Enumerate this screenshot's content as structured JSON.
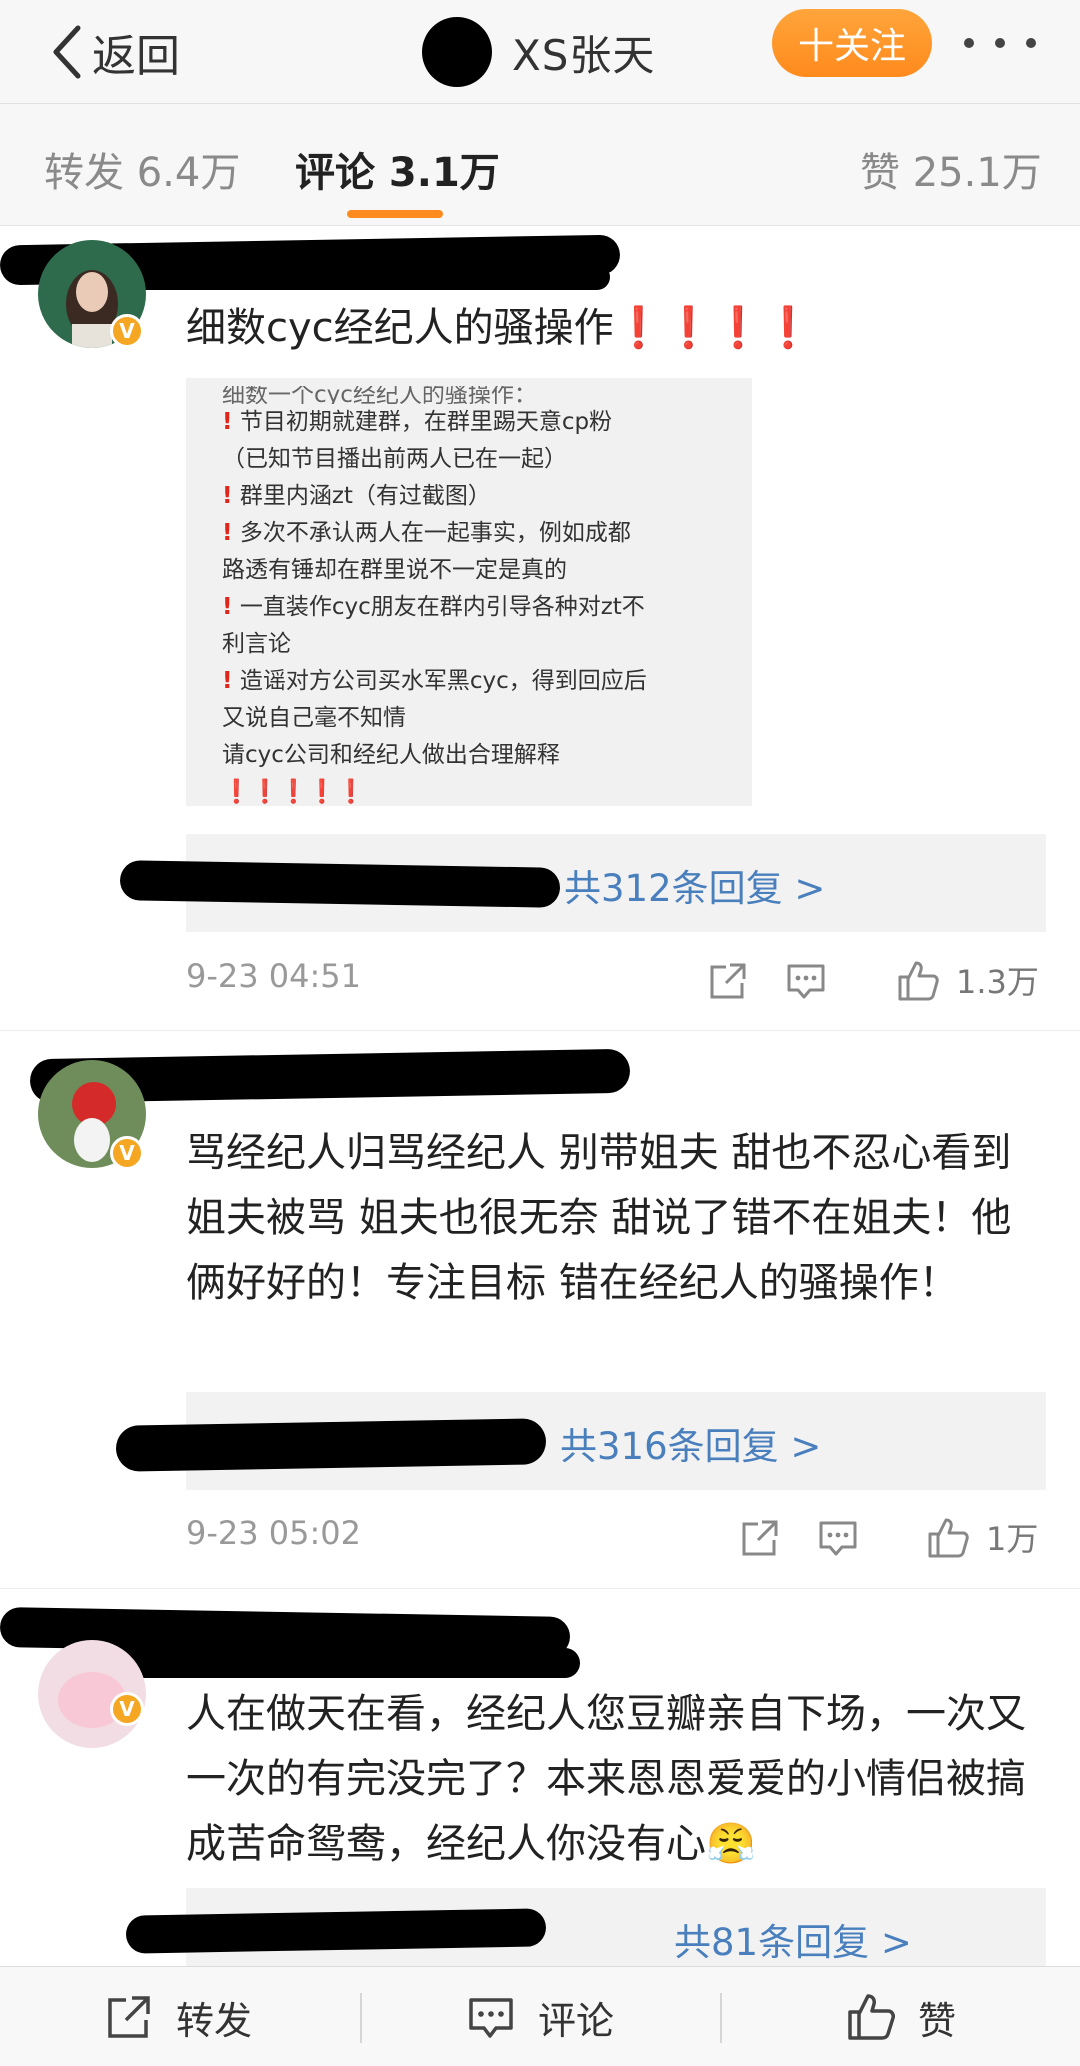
{
  "nav": {
    "back_label": "返回",
    "username": "XS张天",
    "follow_label": "十关注"
  },
  "tabs": {
    "repost": "转发 6.4万",
    "comment": "评论 3.1万",
    "like": "赞 25.1万"
  },
  "comments": [
    {
      "text": "细数cyc经纪人的骚操作",
      "text_suffix": "❗️❗️❗️❗️",
      "image_lines": [
        "细数一个cyc经纪人的骚操作：",
        "节目初期就建群，在群里踢天意cp粉",
        "（已知节目播出前两人已在一起）",
        "群里内涵zt（有过截图）",
        "多次不承认两人在一起事实，例如成都",
        "路透有锤却在群里说不一定是真的",
        "一直装作cyc朋友在群内引导各种对zt不",
        "利言论",
        "造谣对方公司买水军黑cyc，得到回应后",
        "又说自己毫不知情",
        "请cyc公司和经纪人做出合理解释",
        "❗️❗️❗️❗️❗️"
      ],
      "reply_link": "共312条回复 >",
      "time": "9-23 04:51",
      "likes": "1.3万"
    },
    {
      "text": "骂经纪人归骂经纪人 别带姐夫 甜也不忍心看到姐夫被骂 姐夫也很无奈 甜说了错不在姐夫！他俩好好的！专注目标 错在经纪人的骚操作！",
      "reply_link": "共316条回复 >",
      "time": "9-23 05:02",
      "likes": "1万"
    },
    {
      "text": "人在做天在看，经纪人您豆瓣亲自下场，一次又一次的有完没完了？本来恩恩爱爱的小情侣被搞成苦命鸳鸯，经纪人你没有心",
      "text_suffix": "😤",
      "reply_link": "共81条回复 >"
    }
  ],
  "bottom": {
    "repost": "转发",
    "comment": "评论",
    "like": "赞"
  },
  "colors": {
    "accent": "#ff8a1d",
    "link": "#4a7fbd",
    "verified": "#f5a623"
  }
}
